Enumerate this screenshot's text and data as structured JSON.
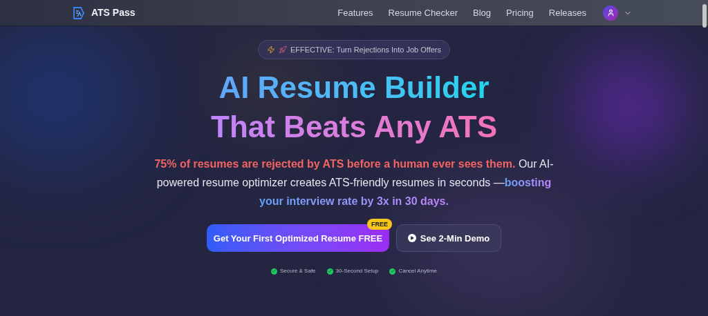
{
  "nav": {
    "brand": "ATS Pass",
    "links": [
      "Features",
      "Resume Checker",
      "Blog",
      "Pricing",
      "Releases"
    ]
  },
  "badge": {
    "text": "EFFECTIVE: Turn Rejections Into Job Offers"
  },
  "headline": [
    "AI Resume Builder",
    "That Beats Any ATS"
  ],
  "intro": "**75% of resumes are rejected by ATS before a human ever sees them.** Our AI-powered resume optimizer creates ATS-friendly resumes in seconds —**boosting your interview rate by 3x in 30 days.**",
  "cta": {
    "primary": "Get Your First Optimized Resume FREE",
    "tag": "FREE",
    "secondary": "See 2-Min Demo"
  },
  "trust": [
    "Secure & Safe",
    "30-Second Setup",
    "Cancel Anytime"
  ]
}
